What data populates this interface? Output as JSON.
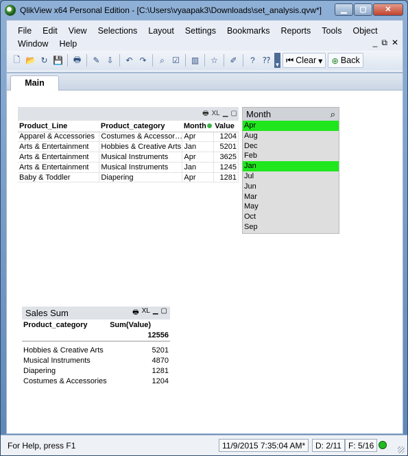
{
  "window": {
    "title": "QlikView x64 Personal Edition - [C:\\Users\\vyaapak3\\Downloads\\set_analysis.qvw*]",
    "controls": [
      "minimize",
      "maximize",
      "close"
    ]
  },
  "menubar": {
    "row1": [
      "File",
      "Edit",
      "View",
      "Selections",
      "Layout",
      "Settings",
      "Bookmarks",
      "Reports",
      "Tools",
      "Object"
    ],
    "row2": [
      "Window",
      "Help"
    ],
    "doc_controls": [
      "_",
      "⧉",
      "✕"
    ]
  },
  "toolbar": {
    "icons": [
      "new-icon",
      "open-icon",
      "reload-icon",
      "save-icon",
      "print-icon",
      "edit-script-icon",
      "reload-data-icon",
      "undo-icon",
      "redo-icon",
      "search-icon",
      "selections-icon",
      "chart-icon",
      "bookmark-icon",
      "properties-icon",
      "help-icon",
      "whats-this-icon"
    ],
    "clear_label": "Clear",
    "back_label": "Back"
  },
  "tabs": [
    {
      "label": "Main",
      "active": true
    }
  ],
  "product_table": {
    "icons": [
      "print-icon",
      "xl-icon",
      "minimize-icon",
      "maximize-icon"
    ],
    "columns": [
      "Product_Line",
      "Product_category",
      "Month",
      "Value"
    ],
    "rows": [
      [
        "Apparel & Accessories",
        "Costumes & Accessor…",
        "Apr",
        "1204"
      ],
      [
        "Arts & Entertainment",
        "Hobbies & Creative Arts",
        "Jan",
        "5201"
      ],
      [
        "Arts & Entertainment",
        "Musical Instruments",
        "Apr",
        "3625"
      ],
      [
        "Arts & Entertainment",
        "Musical Instruments",
        "Jan",
        "1245"
      ],
      [
        "Baby & Toddler",
        "Diapering",
        "Apr",
        "1281"
      ]
    ]
  },
  "month_listbox": {
    "title": "Month",
    "items": [
      {
        "label": "Apr",
        "selected": true
      },
      {
        "label": "Aug",
        "selected": false
      },
      {
        "label": "Dec",
        "selected": false
      },
      {
        "label": "Feb",
        "selected": false
      },
      {
        "label": "Jan",
        "selected": true
      },
      {
        "label": "Jul",
        "selected": false
      },
      {
        "label": "Jun",
        "selected": false
      },
      {
        "label": "Mar",
        "selected": false
      },
      {
        "label": "May",
        "selected": false
      },
      {
        "label": "Oct",
        "selected": false
      },
      {
        "label": "Sep",
        "selected": false
      }
    ],
    "selected_color": "#20e61e"
  },
  "sales_sum": {
    "title": "Sales Sum",
    "icons": [
      "print-icon",
      "xl-icon",
      "minimize-icon",
      "maximize-icon"
    ],
    "columns": [
      "Product_category",
      "Sum(Value)"
    ],
    "total": "12556",
    "rows": [
      [
        "Hobbies & Creative Arts",
        "5201"
      ],
      [
        "Musical Instruments",
        "4870"
      ],
      [
        "Diapering",
        "1281"
      ],
      [
        "Costumes & Accessories",
        "1204"
      ]
    ]
  },
  "statusbar": {
    "help": "For Help, press F1",
    "timestamp": "11/9/2015 7:35:04 AM*",
    "dimensions": "D: 2/11",
    "fields": "F: 5/16",
    "status_color": "#22bb22"
  }
}
